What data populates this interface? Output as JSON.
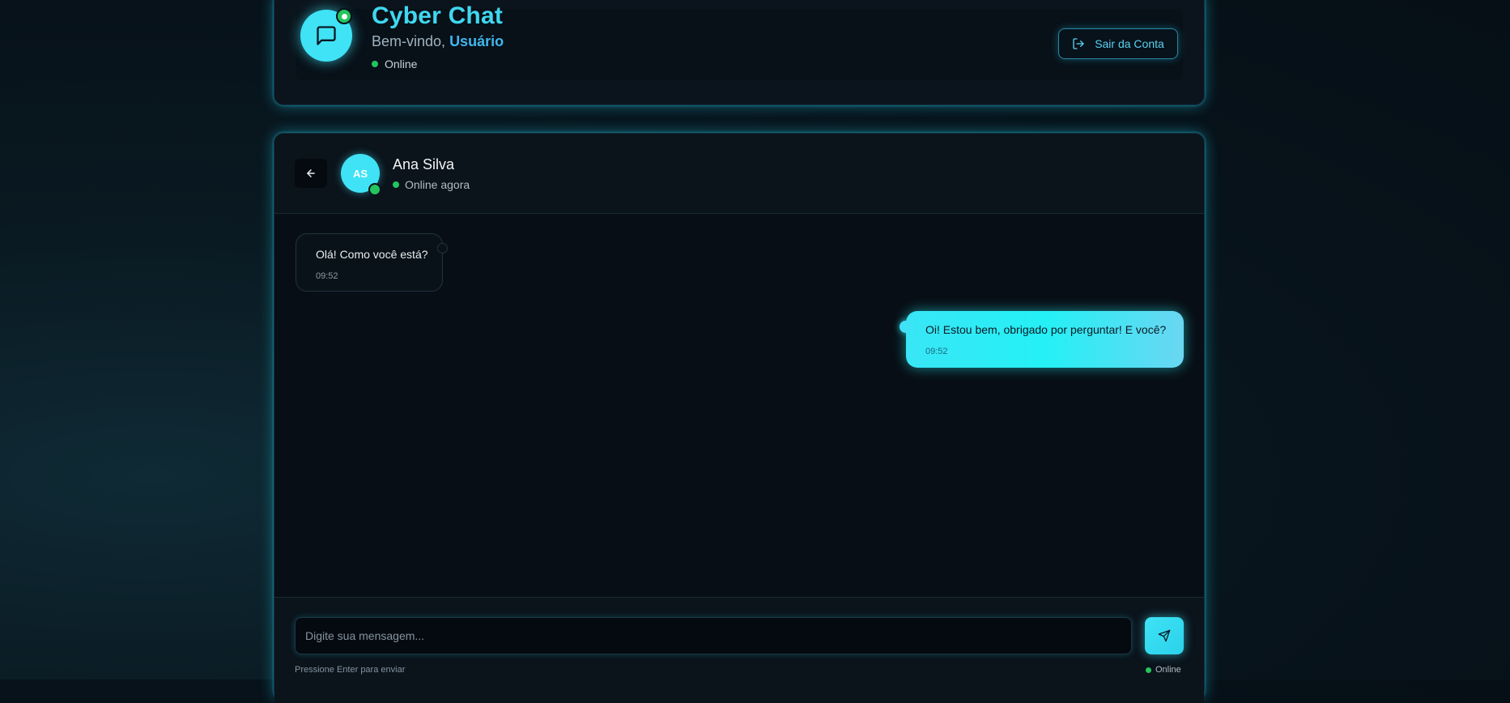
{
  "header": {
    "app_title": "Cyber Chat",
    "welcome_prefix": "Bem-vindo,",
    "username": "Usuário",
    "status": "Online",
    "logout_label": "Sair da Conta",
    "logo_icon": "chat-bubble-icon",
    "logout_icon": "logout-icon"
  },
  "chat": {
    "contact": {
      "initials": "AS",
      "name": "Ana Silva",
      "status": "Online agora"
    },
    "messages": [
      {
        "direction": "incoming",
        "text": "Olá! Como você está?",
        "time": "09:52"
      },
      {
        "direction": "outgoing",
        "text": "Oi! Estou bem, obrigado por perguntar! E você?",
        "time": "09:52"
      }
    ],
    "composer": {
      "placeholder": "Digite sua mensagem...",
      "value": "",
      "hint": "Pressione Enter para enviar",
      "status": "Online",
      "send_icon": "send-icon"
    }
  },
  "colors": {
    "accent": "#3fe3f5",
    "online": "#22c55e",
    "background": "#07121a"
  }
}
